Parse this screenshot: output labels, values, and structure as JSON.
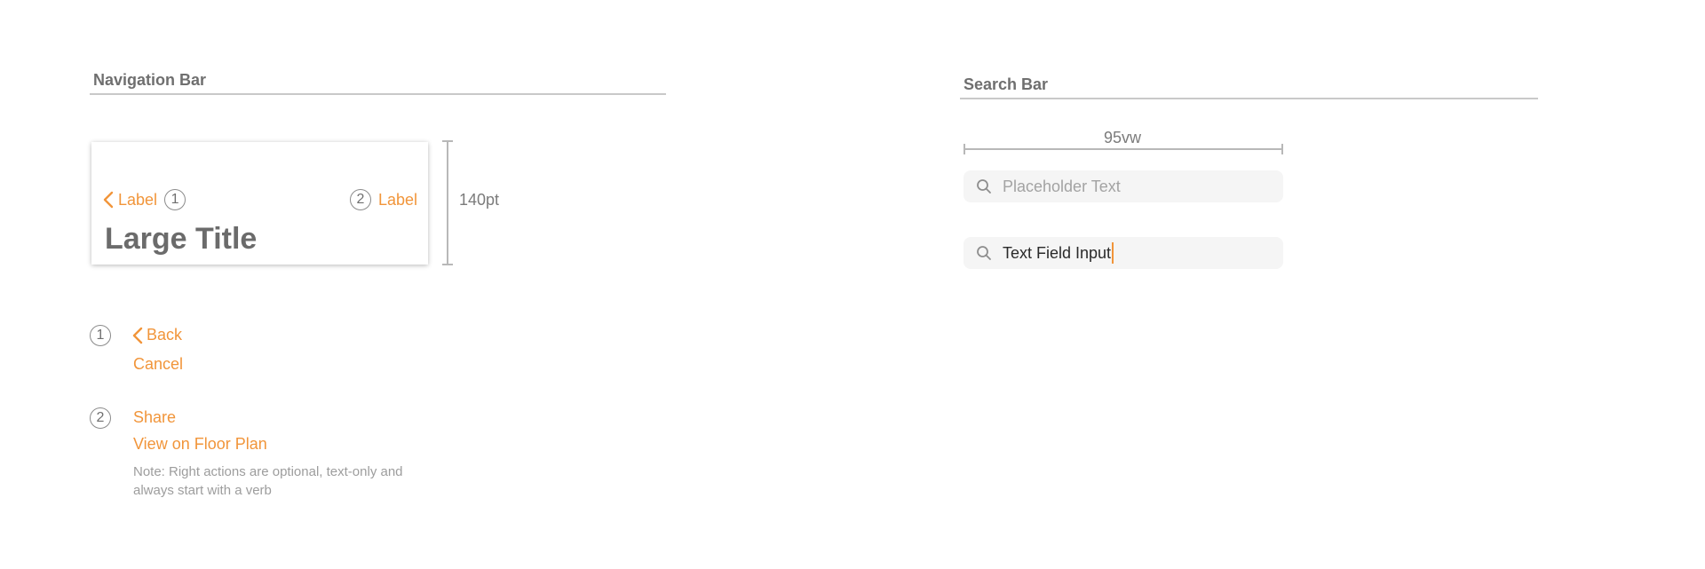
{
  "navigation": {
    "section_title": "Navigation Bar",
    "left_label": "Label",
    "left_marker": "1",
    "right_marker": "2",
    "right_label": "Label",
    "large_title": "Large Title",
    "height_label": "140pt",
    "legend": [
      {
        "marker": "1",
        "items": [
          "Back",
          "Cancel"
        ]
      },
      {
        "marker": "2",
        "items": [
          "Share",
          "View on Floor Plan"
        ]
      }
    ],
    "note": "Note: Right actions are optional, text-only and always start with a verb"
  },
  "search": {
    "section_title": "Search Bar",
    "width_label": "95vw",
    "placeholder": "Placeholder Text",
    "input_value": "Text Field Input"
  },
  "colors": {
    "accent": "#f1953a",
    "heading_gray": "#6f6f6f",
    "rule_gray": "#c9c9c9",
    "field_background": "#f5f5f5"
  },
  "icons": {
    "back": "chevron-left-icon",
    "search": "magnifying-glass-icon"
  }
}
